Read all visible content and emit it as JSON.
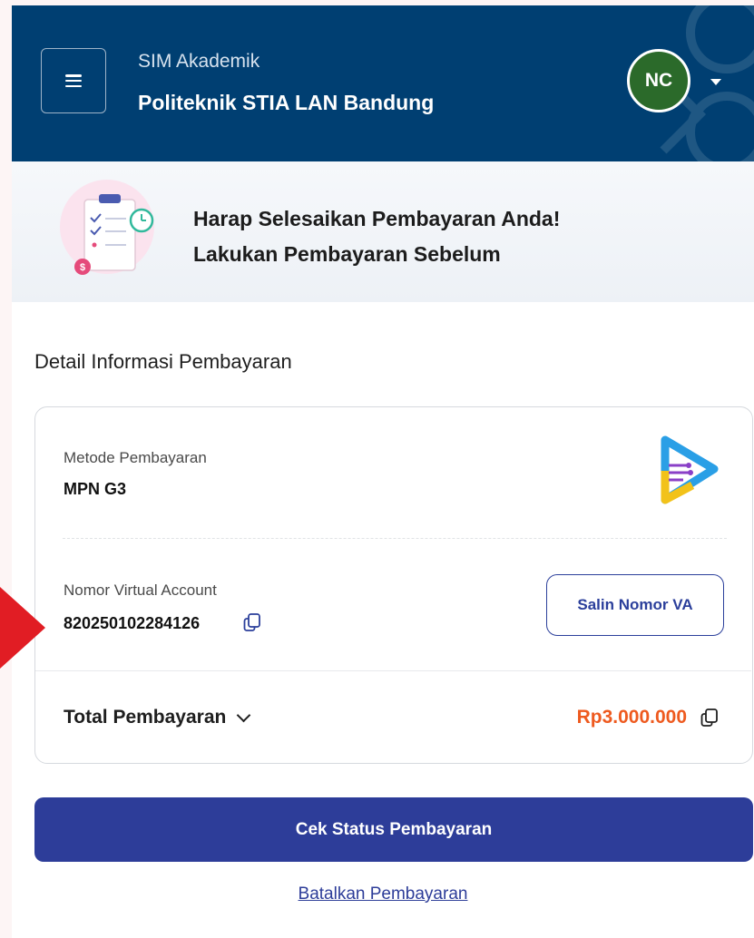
{
  "header": {
    "menu_icon": "hamburger-menu-icon",
    "app_subtitle": "SIM Akademik",
    "app_title": "Politeknik STIA LAN Bandung",
    "avatar_initials": "NC",
    "avatar_color": "#2b6a2a",
    "header_color": "#003f72"
  },
  "banner": {
    "illustration": "payment-checklist-illustration",
    "line1": "Harap Selesaikan Pembayaran Anda!",
    "line2": "Lakukan Pembayaran Sebelum"
  },
  "section": {
    "title": "Detail Informasi Pembayaran"
  },
  "payment": {
    "method_label": "Metode Pembayaran",
    "method_value": "MPN G3",
    "method_logo": "mpn-g3-logo",
    "va_label": "Nomor Virtual Account",
    "va_number": "820250102284126",
    "copy_va_button": "Salin Nomor VA",
    "total_label": "Total Pembayaran",
    "total_amount": "Rp3.000.000",
    "amount_color": "#ee5a1f"
  },
  "actions": {
    "check_status": "Cek Status Pembayaran",
    "cancel": "Batalkan Pembayaran",
    "primary_color": "#2d3d99"
  }
}
